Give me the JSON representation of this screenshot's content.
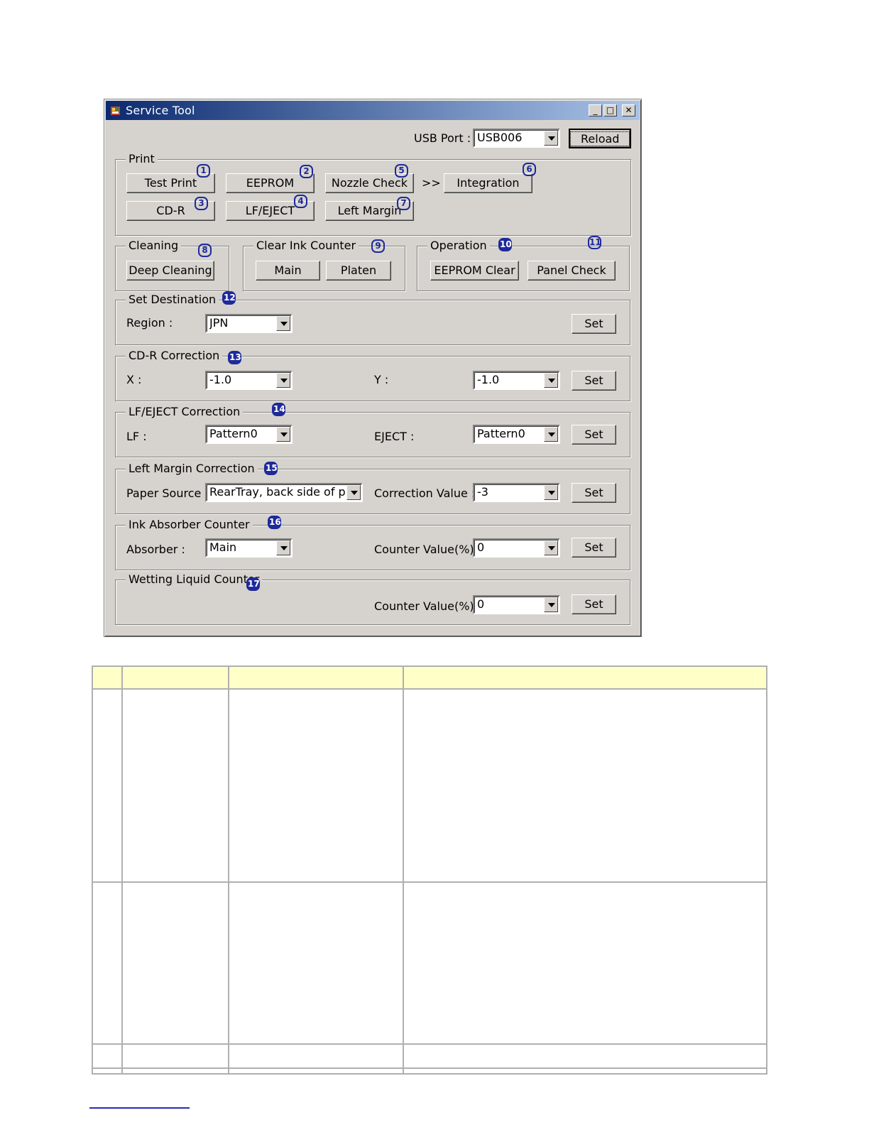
{
  "window": {
    "title": "Service Tool",
    "minimize_glyph": "_",
    "maximize_glyph": "□",
    "close_glyph": "✕"
  },
  "usb": {
    "label": "USB Port :",
    "value": "USB006",
    "reload_label": "Reload"
  },
  "print_group": {
    "legend": "Print",
    "test_print": "Test Print",
    "eeprom": "EEPROM",
    "nozzle_check": "Nozzle Check",
    "arrow": ">>",
    "integration": "Integration",
    "cdr": "CD-R",
    "lf_eject": "LF/EJECT",
    "left_margin": "Left Margin"
  },
  "cleaning": {
    "legend": "Cleaning",
    "deep_cleaning": "Deep Cleaning"
  },
  "clear_ink": {
    "legend": "Clear Ink Counter",
    "main": "Main",
    "platen": "Platen"
  },
  "operation": {
    "legend": "Operation",
    "eeprom_clear": "EEPROM Clear",
    "panel_check": "Panel Check"
  },
  "set_destination": {
    "legend": "Set Destination",
    "region_label": "Region :",
    "region_value": "JPN",
    "set": "Set"
  },
  "cdr_correction": {
    "legend": "CD-R Correction",
    "x_label": "X :",
    "x_value": "-1.0",
    "y_label": "Y :",
    "y_value": "-1.0",
    "set": "Set"
  },
  "lf_eject_correction": {
    "legend": "LF/EJECT Correction",
    "lf_label": "LF :",
    "lf_value": "Pattern0",
    "eject_label": "EJECT :",
    "eject_value": "Pattern0",
    "set": "Set"
  },
  "left_margin_correction": {
    "legend": "Left Margin Correction",
    "paper_label": "Paper Source :",
    "paper_value": "RearTray, back side of pap",
    "corr_label": "Correction Value :",
    "corr_value": "-3",
    "set": "Set"
  },
  "ink_absorber": {
    "legend": "Ink Absorber Counter",
    "absorber_label": "Absorber :",
    "absorber_value": "Main",
    "counter_label": "Counter Value(%) :",
    "counter_value": "0",
    "set": "Set"
  },
  "wetting_liquid": {
    "legend": "Wetting Liquid Counter",
    "counter_label": "Counter Value(%) :",
    "counter_value": "0",
    "set": "Set"
  },
  "badges": [
    "1",
    "2",
    "3",
    "4",
    "5",
    "6",
    "7",
    "8",
    "9",
    "10",
    "11",
    "12",
    "13",
    "14",
    "15",
    "16",
    "17"
  ],
  "colors": {
    "title_start": "#0b2a6f",
    "title_end": "#a9c3e8",
    "dialog_bg": "#d6d3ce",
    "badge": "#1e2a9a",
    "table_header": "#ffffc8"
  }
}
